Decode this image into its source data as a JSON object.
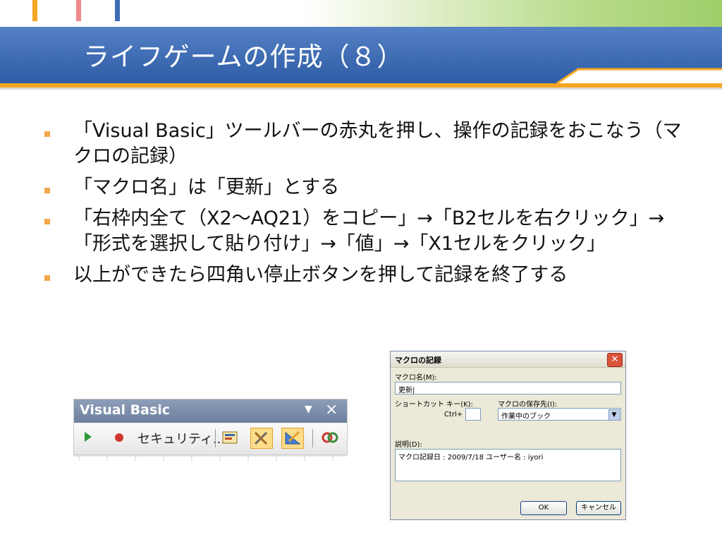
{
  "slide": {
    "title": "ライフゲームの作成（８）",
    "accent_colors": [
      "#f6a623",
      "#f08080",
      "#3f6cb3",
      "#9fcf6a"
    ],
    "bullets": [
      "「Visual Basic」ツールバーの赤丸を押し、操作の記録をおこなう（マクロの記録）",
      "「マクロ名」は「更新」とする",
      "「右枠内全て（X2～AQ21）をコピー」→「B2セルを右クリック」→「形式を選択して貼り付け」→「値」→「X1セルをクリック」",
      "以上ができたら四角い停止ボタンを押して記録を終了する"
    ]
  },
  "vb_toolbar": {
    "title": "Visual Basic",
    "security_label": "セキュリティ...",
    "icons": [
      "run-macro-icon",
      "record-macro-icon",
      "visual-basic-editor-icon",
      "control-toolbox-icon",
      "design-mode-icon",
      "microsoft-script-editor-icon"
    ]
  },
  "macro_dialog": {
    "title": "マクロの記録",
    "name_label": "マクロ名(M):",
    "name_value": "更新|",
    "shortcut_label": "ショートカット キー(K):",
    "ctrl_label": "Ctrl+",
    "shortcut_value": "",
    "store_label": "マクロの保存先(I):",
    "store_value": "作業中のブック",
    "desc_label": "説明(D):",
    "desc_value": "マクロ記録日 : 2009/7/18  ユーザー名 : iyori",
    "ok_label": "OK",
    "cancel_label": "キャンセル"
  }
}
